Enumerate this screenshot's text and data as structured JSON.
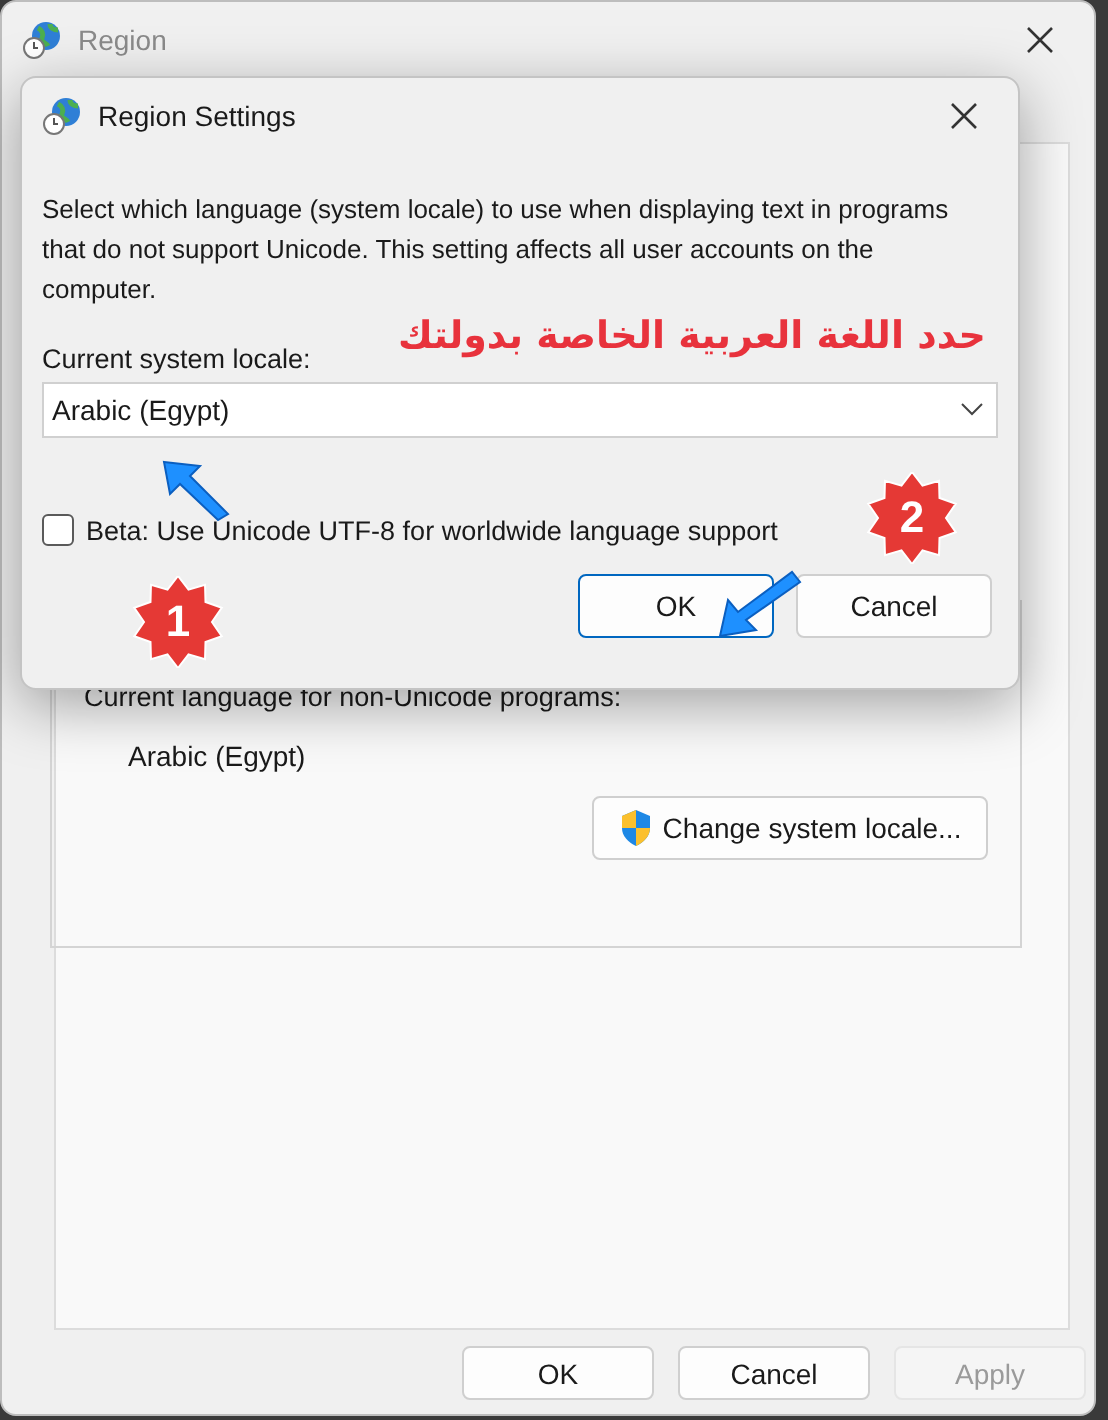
{
  "region_window": {
    "title": "Region",
    "current_language_label": "Current language for non-Unicode programs:",
    "current_language": "Arabic (Egypt)",
    "change_locale_button": "Change system locale...",
    "buttons": [
      {
        "label": "OK",
        "disabled": false
      },
      {
        "label": "Cancel",
        "disabled": false
      },
      {
        "label": "Apply",
        "disabled": true
      }
    ]
  },
  "dialog": {
    "title": "Region Settings",
    "description": "Select which language (system locale) to use when displaying text in programs that do not support Unicode. This setting affects all user accounts on the computer.",
    "annotation": "حدد اللغة العربية الخاصة بدولتك",
    "locale_label": "Current system locale:",
    "locale_value": "Arabic (Egypt)",
    "beta_checkbox": {
      "label": "Beta: Use Unicode UTF-8 for worldwide language support",
      "checked": false
    },
    "buttons": [
      {
        "label": "OK",
        "focused": true
      },
      {
        "label": "Cancel",
        "focused": false
      }
    ]
  },
  "step_badges": [
    "1",
    "2"
  ]
}
